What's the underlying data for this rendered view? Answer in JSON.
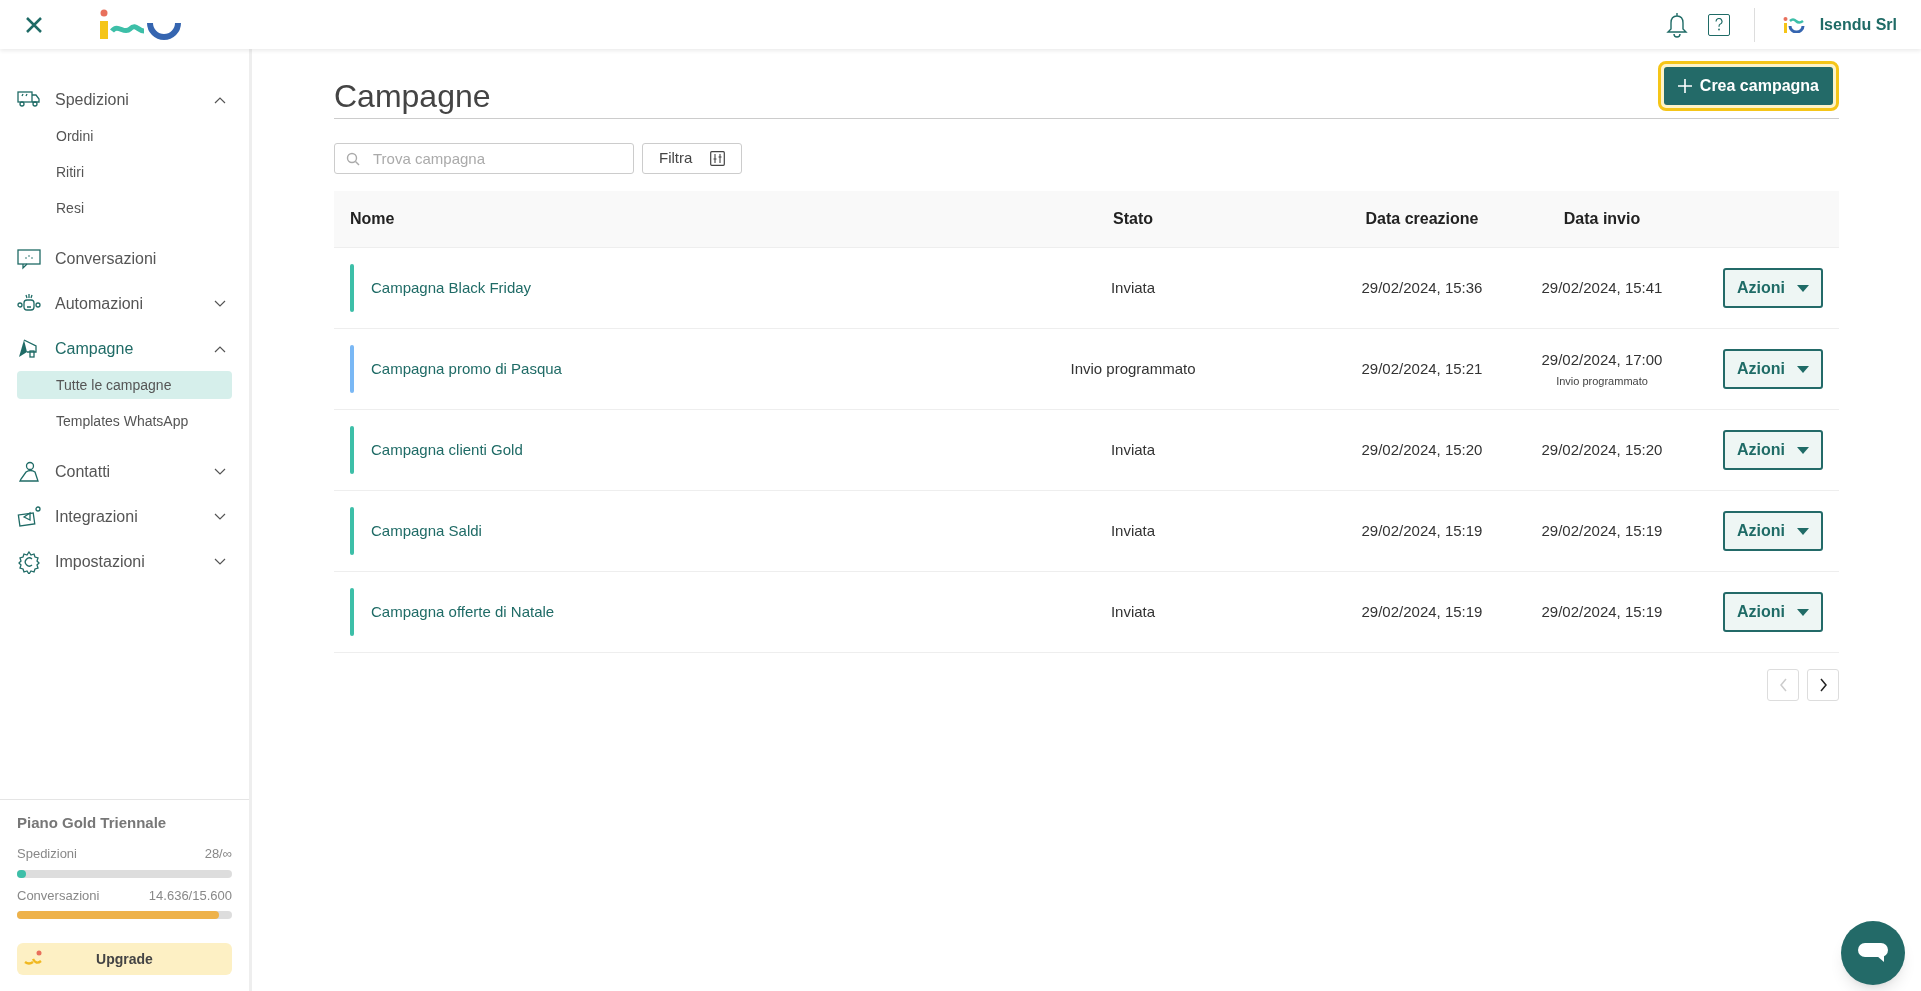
{
  "header": {
    "account": "Isendu Srl"
  },
  "sidebar": {
    "items": [
      {
        "label": "Spedizioni",
        "kind": "group",
        "expanded": true,
        "selected": false,
        "children": [
          {
            "label": "Ordini",
            "selected": false
          },
          {
            "label": "Ritiri",
            "selected": false
          },
          {
            "label": "Resi",
            "selected": false
          }
        ]
      },
      {
        "label": "Conversazioni",
        "kind": "link",
        "selected": false
      },
      {
        "label": "Automazioni",
        "kind": "group",
        "expanded": false,
        "selected": false
      },
      {
        "label": "Campagne",
        "kind": "group",
        "expanded": true,
        "selected": true,
        "children": [
          {
            "label": "Tutte le campagne",
            "selected": true
          },
          {
            "label": "Templates WhatsApp",
            "selected": false
          }
        ]
      },
      {
        "label": "Contatti",
        "kind": "group",
        "expanded": false,
        "selected": false
      },
      {
        "label": "Integrazioni",
        "kind": "group",
        "expanded": false,
        "selected": false
      },
      {
        "label": "Impostazioni",
        "kind": "group",
        "expanded": false,
        "selected": false
      }
    ],
    "plan": {
      "title": "Piano Gold Triennale",
      "meters": [
        {
          "label": "Spedizioni",
          "reading": "28/∞",
          "level": 0.04,
          "color": "#3dbfa8"
        },
        {
          "label": "Conversazioni",
          "reading": "14.636/15.600",
          "level": 0.94,
          "color": "#eeb24a"
        }
      ],
      "upgrade": "Upgrade"
    }
  },
  "page": {
    "title": "Campagne",
    "create_button": "Crea campagna",
    "search": {
      "placeholder": "Trova campagna"
    },
    "filter_button": "Filtra"
  },
  "table": {
    "columns": [
      "Nome",
      "Stato",
      "Data creazione",
      "Data invio"
    ],
    "rows": [
      {
        "name": "Campagna Black Friday",
        "color": "#3dbfa8",
        "status": "Inviata",
        "created": "29/02/2024, 15:36",
        "sent": "29/02/2024, 15:41",
        "action": "Azioni"
      },
      {
        "name": "Campagna promo di Pasqua",
        "color": "#7ab8f5",
        "status": "Invio programmato",
        "created": "29/02/2024, 15:21",
        "sent": "29/02/2024, 17:00",
        "sent_note": "Invio programmato",
        "action": "Azioni"
      },
      {
        "name": "Campagna clienti Gold",
        "color": "#3dbfa8",
        "status": "Inviata",
        "created": "29/02/2024, 15:20",
        "sent": "29/02/2024, 15:20",
        "action": "Azioni"
      },
      {
        "name": "Campagna Saldi",
        "color": "#3dbfa8",
        "status": "Inviata",
        "created": "29/02/2024, 15:19",
        "sent": "29/02/2024, 15:19",
        "action": "Azioni"
      },
      {
        "name": "Campagna offerte di Natale",
        "color": "#3dbfa8",
        "status": "Inviata",
        "created": "29/02/2024, 15:19",
        "sent": "29/02/2024, 15:19",
        "action": "Azioni"
      }
    ]
  },
  "pagination": {
    "previous_disabled": true,
    "next_disabled": false
  }
}
